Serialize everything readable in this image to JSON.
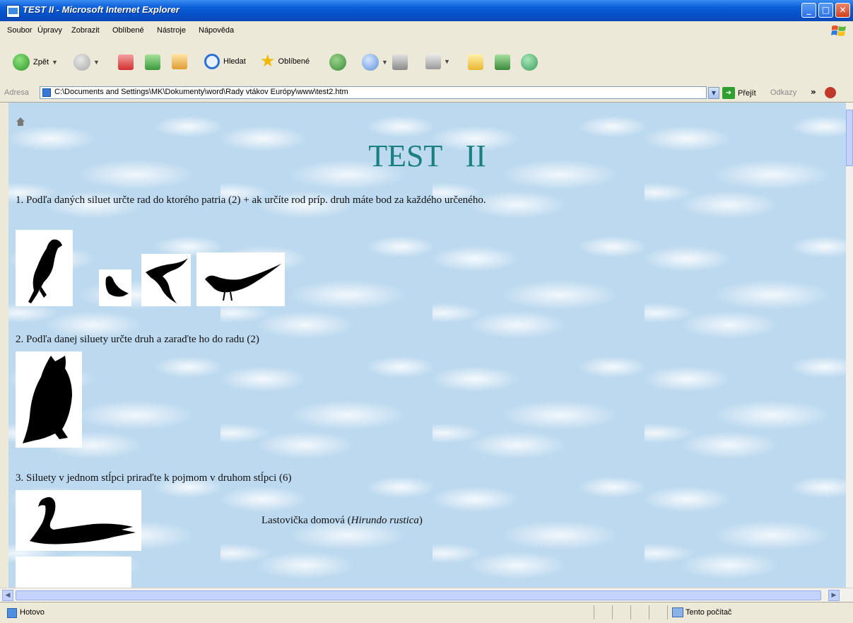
{
  "window": {
    "title": "TEST   II - Microsoft Internet Explorer",
    "minimize": "_",
    "maximize": "□",
    "close": "✕"
  },
  "menu": [
    "Soubor",
    "Úpravy",
    "Zobrazit",
    "Oblíbené",
    "Nástroje",
    "Nápověda"
  ],
  "toolbar": {
    "back_label": "Zpět",
    "search_label": "Hledat",
    "favorites_label": "Oblíbené"
  },
  "address": {
    "label": "Adresa",
    "value": "C:\\Documents and Settings\\MK\\Dokumenty\\word\\Rady vtákov Európy\\www\\test2.htm",
    "go_label": "Přejít",
    "links_label": "Odkazy",
    "more_chevron": "»"
  },
  "page": {
    "title": "TEST   II",
    "q1": "1. Podľa daných siluet určte rad do ktorého patria (2) + ak určíte rod príp. druh máte bod za každého určeného.",
    "q2": "2. Podľa danej siluety určte druh a zaraďte ho do radu (2)",
    "q3": "3.  Siluety v jednom stĺpci priraďte k pojmom v druhom stĺpci (6)",
    "answer_prefix": "Lastovička domová (",
    "answer_latin": "Hirundo rustica",
    "answer_suffix": ")"
  },
  "status": {
    "text": "Hotovo",
    "zone": "Tento počítač"
  },
  "colors": {
    "title_teal": "#1a7f80",
    "xp_blue": "#0550c8"
  },
  "icons": [
    "back-icon",
    "forward-icon",
    "stop-icon",
    "refresh-icon",
    "home-icon",
    "search-icon",
    "favorites-icon",
    "history-icon",
    "mail-icon",
    "print-icon",
    "edit-icon",
    "folder-icon",
    "messenger-icon"
  ]
}
